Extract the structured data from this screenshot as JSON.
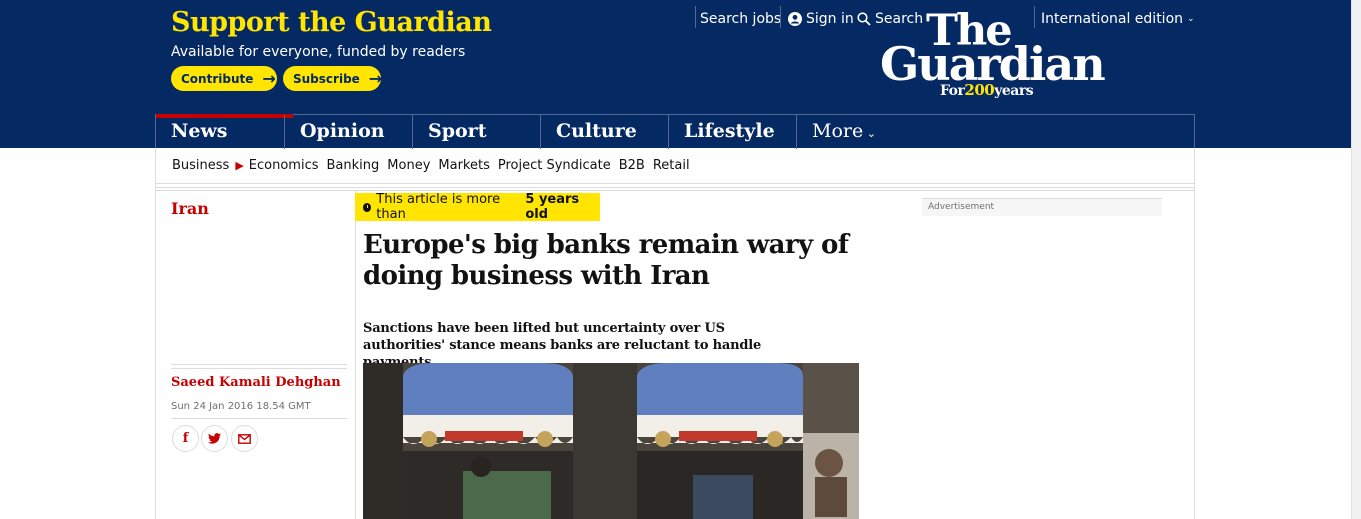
{
  "header": {
    "support_title": "Support the Guardian",
    "support_sub": "Available for everyone, funded by readers",
    "contribute_label": "Contribute",
    "subscribe_label": "Subscribe",
    "search_jobs": "Search jobs",
    "sign_in": "Sign in",
    "search": "Search",
    "edition": "International edition",
    "logo": {
      "the": "The",
      "guardian": "Guardian",
      "tag_prefix": "For",
      "tag_years_num": "200",
      "tag_suffix": "years"
    }
  },
  "nav": {
    "pillars": [
      "News",
      "Opinion",
      "Sport",
      "Culture",
      "Lifestyle"
    ],
    "more": "More"
  },
  "subnav": [
    "Business",
    "Economics",
    "Banking",
    "Money",
    "Markets",
    "Project Syndicate",
    "B2B",
    "Retail"
  ],
  "article": {
    "section": "Iran",
    "age_prefix": "This article is more than",
    "age_value": "5 years old",
    "headline": "Europe's big banks remain wary of doing business with Iran",
    "standfirst": "Sanctions have been lifted but uncertainty over US authorities' stance means banks are reluctant to handle payments",
    "byline": "Saeed Kamali Dehghan",
    "date": "Sun 24 Jan 2016 18.54 GMT"
  },
  "advert_label": "Advertisement",
  "colors": {
    "brand_blue": "#052962",
    "accent_yellow": "#ffe500",
    "news_red": "#c70000"
  },
  "icons": [
    "arrow-right-icon",
    "user-icon",
    "search-icon",
    "chevron-down-icon",
    "clock-icon",
    "facebook-icon",
    "twitter-icon",
    "email-icon"
  ]
}
